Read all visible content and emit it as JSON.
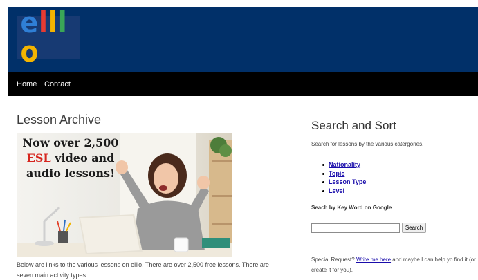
{
  "header": {
    "logo_letters": [
      "e",
      "l",
      "l",
      "l",
      "o"
    ],
    "logo_colors": [
      "#2f7fd6",
      "#e83b32",
      "#f4b400",
      "#3aa657",
      "#f4b400"
    ],
    "brand_color": "#013069"
  },
  "nav": {
    "items": [
      {
        "label": "Home"
      },
      {
        "label": "Contact"
      }
    ]
  },
  "main": {
    "title": "Lesson Archive",
    "banner": {
      "line1": "Now over 2,500",
      "line2_red": "ESL",
      "line2_rest": "video and",
      "line3": "audio lessons!"
    },
    "description": "Below are links to the various lessons on elllo. There are over 2,500 free lessons. There are seven main activity types."
  },
  "sidebar": {
    "title": "Search and Sort",
    "subtitle": "Search for lessons by the various catergories.",
    "categories": [
      {
        "label": "Nationality"
      },
      {
        "label": "Topic"
      },
      {
        "label": "Lesson Type"
      },
      {
        "label": "Level"
      }
    ],
    "google_label": "Seach by Key Word on Google",
    "search_value": "",
    "search_button": "Search",
    "special_prefix": "Special Request?",
    "special_link": "Write me here",
    "special_suffix": "and maybe I can help yo find it (or create it for you)."
  }
}
